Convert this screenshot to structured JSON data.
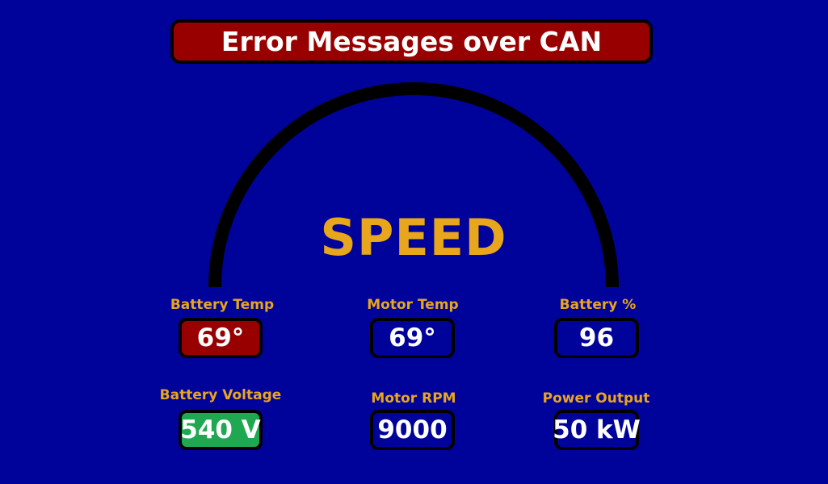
{
  "banner": {
    "text": "Error Messages over CAN",
    "color": "#980000"
  },
  "gauge": {
    "label": "SPEED"
  },
  "readouts": [
    {
      "id": "battery-temp",
      "label": "Battery Temp",
      "value": "69°",
      "state": "alert",
      "color": "#980000"
    },
    {
      "id": "motor-temp",
      "label": "Motor Temp",
      "value": "69°",
      "state": "normal",
      "color": "#00039a"
    },
    {
      "id": "battery-percent",
      "label": "Battery %",
      "value": "96",
      "state": "normal",
      "color": "#00039a"
    },
    {
      "id": "battery-voltage",
      "label": "Battery Voltage",
      "value": "540 V",
      "state": "ok",
      "color": "#1fa851"
    },
    {
      "id": "motor-rpm",
      "label": "Motor RPM",
      "value": "9000",
      "state": "normal",
      "color": "#00039a"
    },
    {
      "id": "power-output",
      "label": "Power Output",
      "value": "50 kW",
      "state": "normal",
      "color": "#00039a"
    }
  ],
  "theme": {
    "background": "#00039a",
    "accent": "#e8a61c",
    "text": "#ffffff"
  }
}
